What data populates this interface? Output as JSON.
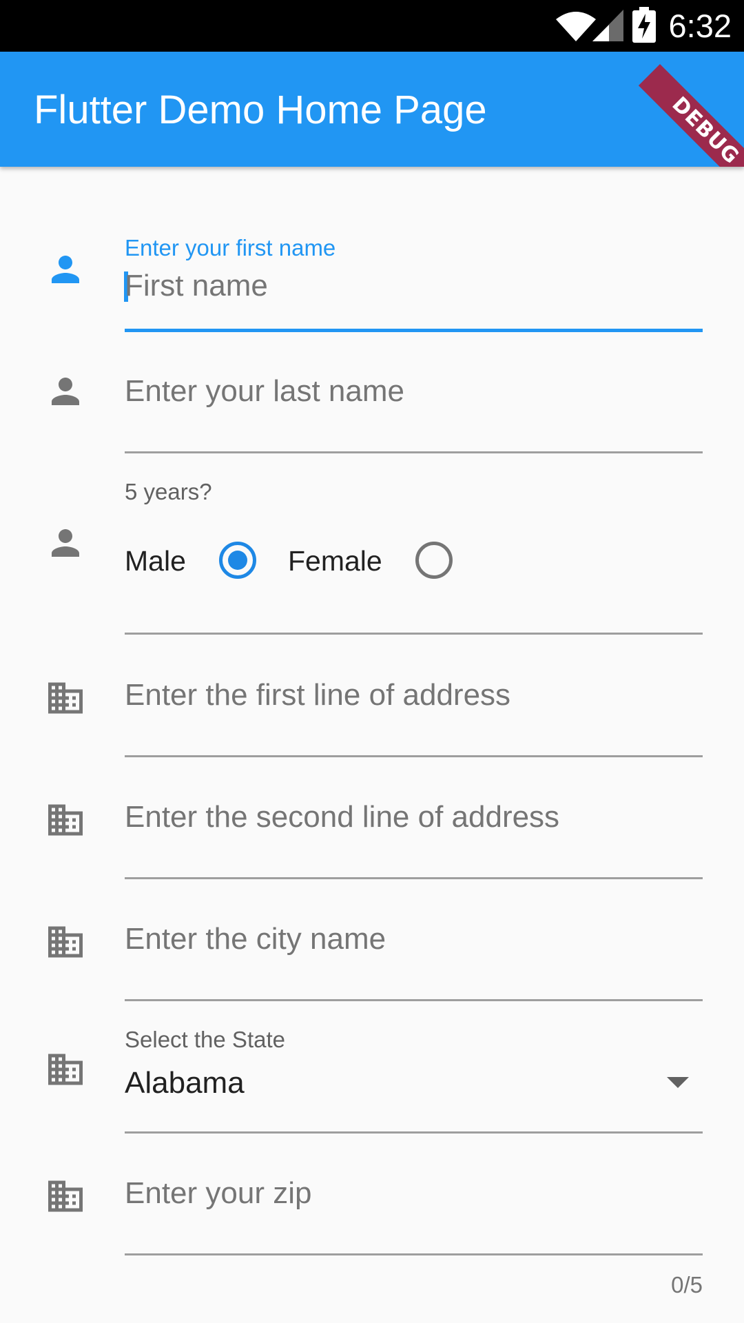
{
  "status_bar": {
    "time": "6:32",
    "icons": [
      "wifi-icon",
      "cell-signal-icon",
      "battery-charging-icon"
    ]
  },
  "app_bar": {
    "title": "Flutter Demo Home Page",
    "debug_banner": "DEBUG",
    "color": "#2196f3"
  },
  "form": {
    "first_name": {
      "icon": "person-icon",
      "label": "Enter your first name",
      "placeholder": "First name",
      "focused": true
    },
    "last_name": {
      "icon": "person-icon",
      "placeholder": "Enter your last name"
    },
    "gender": {
      "icon": "person-icon",
      "helper": "5 years?",
      "options": [
        {
          "label": "Male",
          "selected": true
        },
        {
          "label": "Female",
          "selected": false
        }
      ]
    },
    "address_line1": {
      "icon": "business-icon",
      "placeholder": "Enter the first line of address"
    },
    "address_line2": {
      "icon": "business-icon",
      "placeholder": "Enter the second line of address"
    },
    "city": {
      "icon": "business-icon",
      "placeholder": "Enter the city name"
    },
    "state": {
      "icon": "business-icon",
      "label": "Select the State",
      "value": "Alabama"
    },
    "zip": {
      "icon": "business-icon",
      "placeholder": "Enter your zip",
      "counter": "0/5"
    }
  },
  "colors": {
    "accent": "#2196f3",
    "icon_inactive": "#757575",
    "debug_banner": "#9c2a4d"
  }
}
